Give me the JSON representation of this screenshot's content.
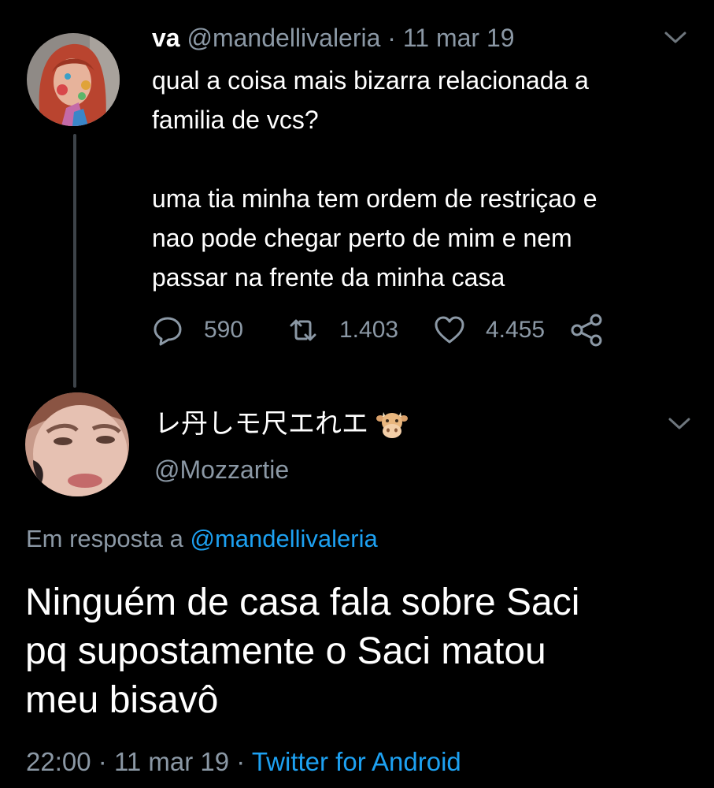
{
  "tweet1": {
    "name": "va",
    "handle": "@mandellivaleria",
    "separator": "·",
    "date": "11 mar 19",
    "lines": [
      "qual a coisa mais bizarra relacionada a",
      "familia de vcs?",
      "",
      "uma tia minha tem ordem de restriçao e",
      "nao pode chegar perto de mim e nem",
      "passar na frente da minha casa"
    ],
    "replies": "590",
    "retweets": "1.403",
    "likes": "4.455"
  },
  "tweet2": {
    "name": "レ丹しモ尺エれエ",
    "name_emoji": "cow-face-emoji",
    "handle": "@Mozzartie",
    "reply_prefix": "Em resposta a",
    "reply_to": "@mandellivaleria",
    "lines": [
      "Ninguém de casa fala sobre Saci",
      "pq supostamente o Saci matou",
      "meu bisavô"
    ],
    "time": "22:00",
    "separator": "·",
    "date": "11 mar 19",
    "source": "Twitter for Android"
  },
  "colors": {
    "background": "#000000",
    "text": "#ffffff",
    "muted": "#8b98a5",
    "link": "#1da1f2"
  },
  "icons": [
    "chevron-down-icon",
    "reply-icon",
    "retweet-icon",
    "like-icon",
    "share-icon"
  ]
}
